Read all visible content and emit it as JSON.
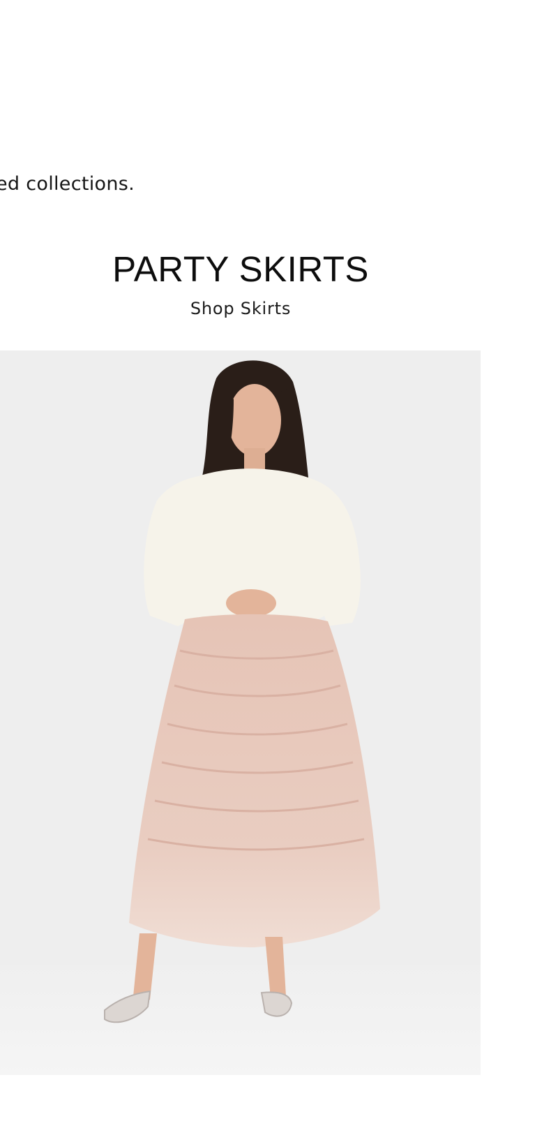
{
  "intro": {
    "text": "ed collections."
  },
  "collection": {
    "title": "PARTY SKIRTS",
    "link_label": "Shop Skirts"
  },
  "hero": {
    "alt": "",
    "colors": {
      "background": "#eeeeee",
      "sweater": "#f6f3ea",
      "skirt": "#e8c9bd",
      "hair": "#2a1e18",
      "skin": "#e3b49a",
      "shoes": "#dcd6d2"
    }
  }
}
